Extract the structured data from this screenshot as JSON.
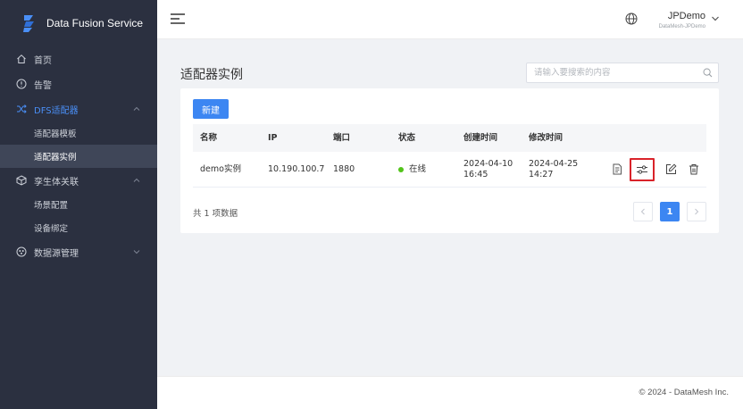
{
  "app": {
    "name": "Data Fusion Service"
  },
  "sidebar": {
    "items": [
      {
        "label": "首页"
      },
      {
        "label": "告警"
      },
      {
        "label": "DFS适配器"
      },
      {
        "label": "孪生体关联"
      },
      {
        "label": "数据源管理"
      }
    ],
    "dfs_sub": [
      {
        "label": "适配器模板"
      },
      {
        "label": "适配器实例"
      }
    ],
    "twin_sub": [
      {
        "label": "场景配置"
      },
      {
        "label": "设备绑定"
      }
    ]
  },
  "header": {
    "user_name": "JPDemo",
    "user_org": "DataMesh-JPDemo"
  },
  "main": {
    "title": "适配器实例",
    "search_placeholder": "请输入要搜索的内容",
    "new_button": "新建",
    "columns": [
      "名称",
      "IP",
      "端口",
      "状态",
      "创建时间",
      "修改时间"
    ],
    "rows": [
      {
        "name": "demo实例",
        "ip": "10.190.100.7",
        "port": "1880",
        "status": "在线",
        "created_date": "2024-04-10",
        "created_time": "16:45",
        "modified_date": "2024-04-25",
        "modified_time": "14:27"
      }
    ],
    "total_text": "共 1 项数据",
    "current_page": "1"
  },
  "footer": {
    "text": "© 2024 - DataMesh Inc."
  },
  "colors": {
    "sidebar_bg": "#2b3040",
    "accent": "#3c86f2",
    "online": "#52c41a",
    "highlight_border": "#d9232a"
  }
}
